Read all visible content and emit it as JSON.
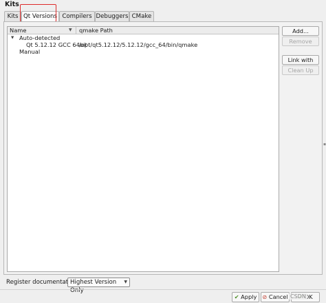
{
  "section_title": "Kits",
  "tabs": [
    {
      "label": "Kits"
    },
    {
      "label": "Qt Versions",
      "active": true
    },
    {
      "label": "Compilers"
    },
    {
      "label": "Debuggers"
    },
    {
      "label": "CMake"
    }
  ],
  "table": {
    "columns": [
      "Name",
      "qmake Path"
    ],
    "rows": [
      {
        "name": "Auto-detected",
        "path": "",
        "expanded": true
      },
      {
        "name": "Qt 5.12.12 GCC 64bit",
        "path": "/opt/qt5.12.12/5.12.12/gcc_64/bin/qmake"
      },
      {
        "name": "Manual",
        "path": ""
      }
    ]
  },
  "side_buttons": {
    "add": "Add...",
    "remove": "Remove",
    "link_with_qt": "Link with Qt...",
    "clean_up": "Clean Up"
  },
  "register_doc": {
    "label": "Register documentation:",
    "value": "Highest Version Only"
  },
  "footer": {
    "apply": "Apply",
    "cancel": "Cancel",
    "ok": "OK"
  },
  "watermark": "CSDN",
  "colors": {
    "annotation": "#dd2a2a",
    "apply_check": "#4b8d24"
  }
}
